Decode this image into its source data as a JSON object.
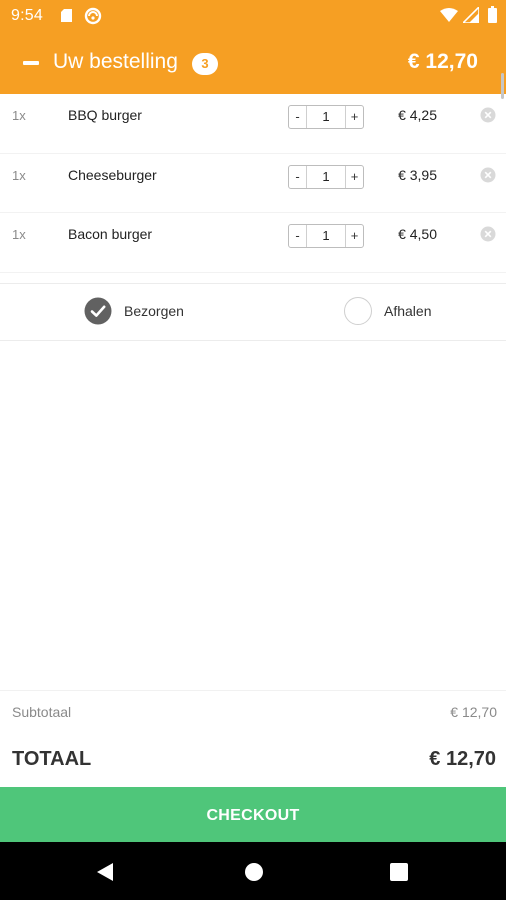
{
  "status_bar": {
    "time": "9:54",
    "icons": [
      "sd-card-icon",
      "sync-icon",
      "wifi-icon",
      "signal-icon",
      "battery-icon"
    ]
  },
  "header": {
    "title": "Uw bestelling",
    "item_count": "3",
    "total": "€ 12,70",
    "accent_color": "#f69f23",
    "collapse_icon": "minus-icon"
  },
  "cart": {
    "items": [
      {
        "qty_label": "1x",
        "name": "BBQ burger",
        "quantity": "1",
        "minus": "-",
        "plus": "+",
        "price": "€ 4,25"
      },
      {
        "qty_label": "1x",
        "name": "Cheeseburger",
        "quantity": "1",
        "minus": "-",
        "plus": "+",
        "price": "€ 3,95"
      },
      {
        "qty_label": "1x",
        "name": "Bacon burger",
        "quantity": "1",
        "minus": "-",
        "plus": "+",
        "price": "€ 4,50"
      }
    ]
  },
  "delivery": {
    "options": [
      {
        "label": "Bezorgen",
        "selected": true
      },
      {
        "label": "Afhalen",
        "selected": false
      }
    ]
  },
  "summary": {
    "subtotal_label": "Subtotaal",
    "subtotal_value": "€ 12,70",
    "total_label": "TOTAAL",
    "total_value": "€ 12,70"
  },
  "checkout": {
    "label": "CHECKOUT",
    "color": "#4fc67a"
  },
  "nav_bar": {
    "icons": [
      "back-icon",
      "home-icon",
      "recents-icon"
    ]
  }
}
